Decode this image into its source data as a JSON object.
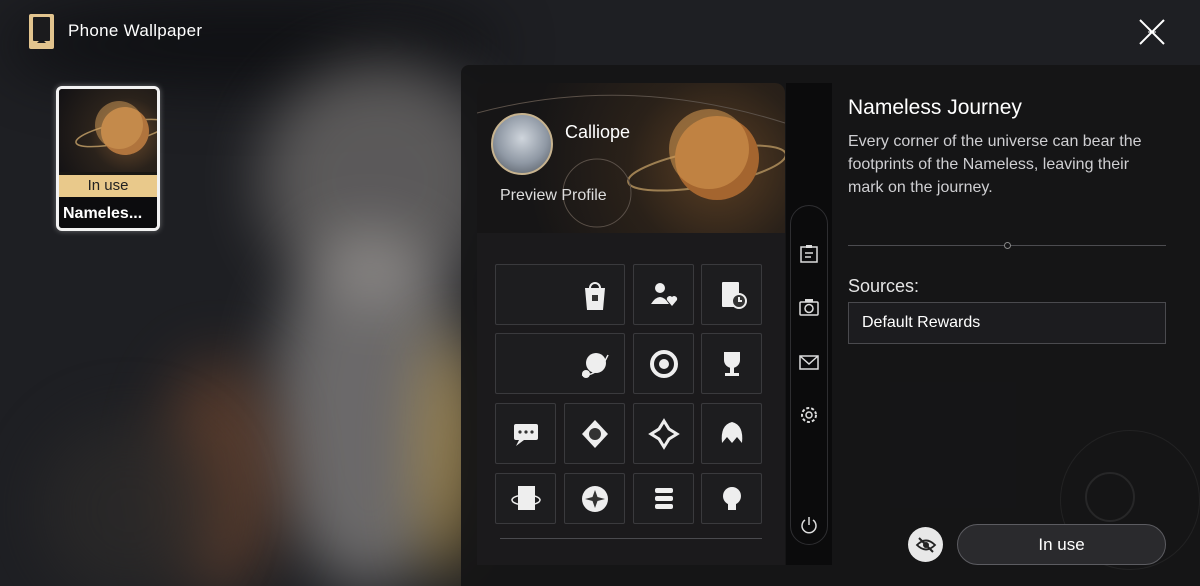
{
  "header": {
    "title": "Phone Wallpaper",
    "icon": "phone-icon",
    "close_icon": "close-icon"
  },
  "wallpaper_list": {
    "items": [
      {
        "badge": "In use",
        "name": "Nameles..."
      }
    ]
  },
  "preview": {
    "player_name": "Calliope",
    "preview_link": "Preview Profile",
    "tiles": [
      {
        "icon": "shop-bag-icon"
      },
      {
        "icon": "friends-icon"
      },
      {
        "icon": "notebook-clock-icon"
      },
      {
        "icon": "planet-orbit-icon"
      },
      {
        "icon": "ring-emblem-icon"
      },
      {
        "icon": "trophy-icon"
      },
      {
        "icon": "chat-bubble-icon"
      },
      {
        "icon": "crest-icon"
      },
      {
        "icon": "flower-emblem-icon"
      },
      {
        "icon": "character-hair-icon"
      },
      {
        "icon": "card-orbit-icon"
      },
      {
        "icon": "star-badge-icon"
      },
      {
        "icon": "book-stack-icon"
      },
      {
        "icon": "lightbulb-icon"
      }
    ],
    "rail_icons": [
      "clipboard-icon",
      "camera-icon",
      "mail-icon",
      "settings-icon",
      "power-icon"
    ]
  },
  "detail": {
    "title": "Nameless Journey",
    "description": "Every corner of the universe can bear the footprints of the Nameless, leaving their mark on the journey.",
    "sources_label": "Sources:",
    "sources_value": "Default Rewards",
    "action_label": "In use",
    "hide_icon": "eye-slash-icon"
  },
  "colors": {
    "accent_gold": "#e9c98b",
    "panel_bg": "#141416",
    "button_bg": "#2a2a2d"
  }
}
